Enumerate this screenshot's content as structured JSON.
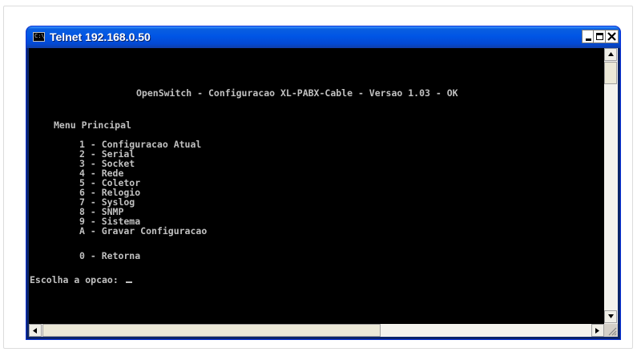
{
  "window": {
    "title": "Telnet 192.168.0.50",
    "icon": "console-icon",
    "icon_text": "C:\\",
    "controls": [
      "minimize-icon",
      "maximize-icon",
      "close-icon"
    ]
  },
  "terminal": {
    "header": "OpenSwitch - Configuracao XL-PABX-Cable - Versao 1.03 - OK",
    "menu_title": "Menu Principal",
    "menu_items": [
      "1 - Configuracao Atual",
      "2 - Serial",
      "3 - Socket",
      "4 - Rede",
      "5 - Coletor",
      "6 - Relogio",
      "7 - Syslog",
      "8 - SNMP",
      "9 - Sistema",
      "A - Gravar Configuracao"
    ],
    "return_item": "0 - Retorna",
    "prompt": "Escolha a opcao: "
  },
  "colors": {
    "title_bar": "#0055e5",
    "terminal_bg": "#000000",
    "terminal_fg": "#c0c0c0",
    "close_button": "#d7412c"
  }
}
